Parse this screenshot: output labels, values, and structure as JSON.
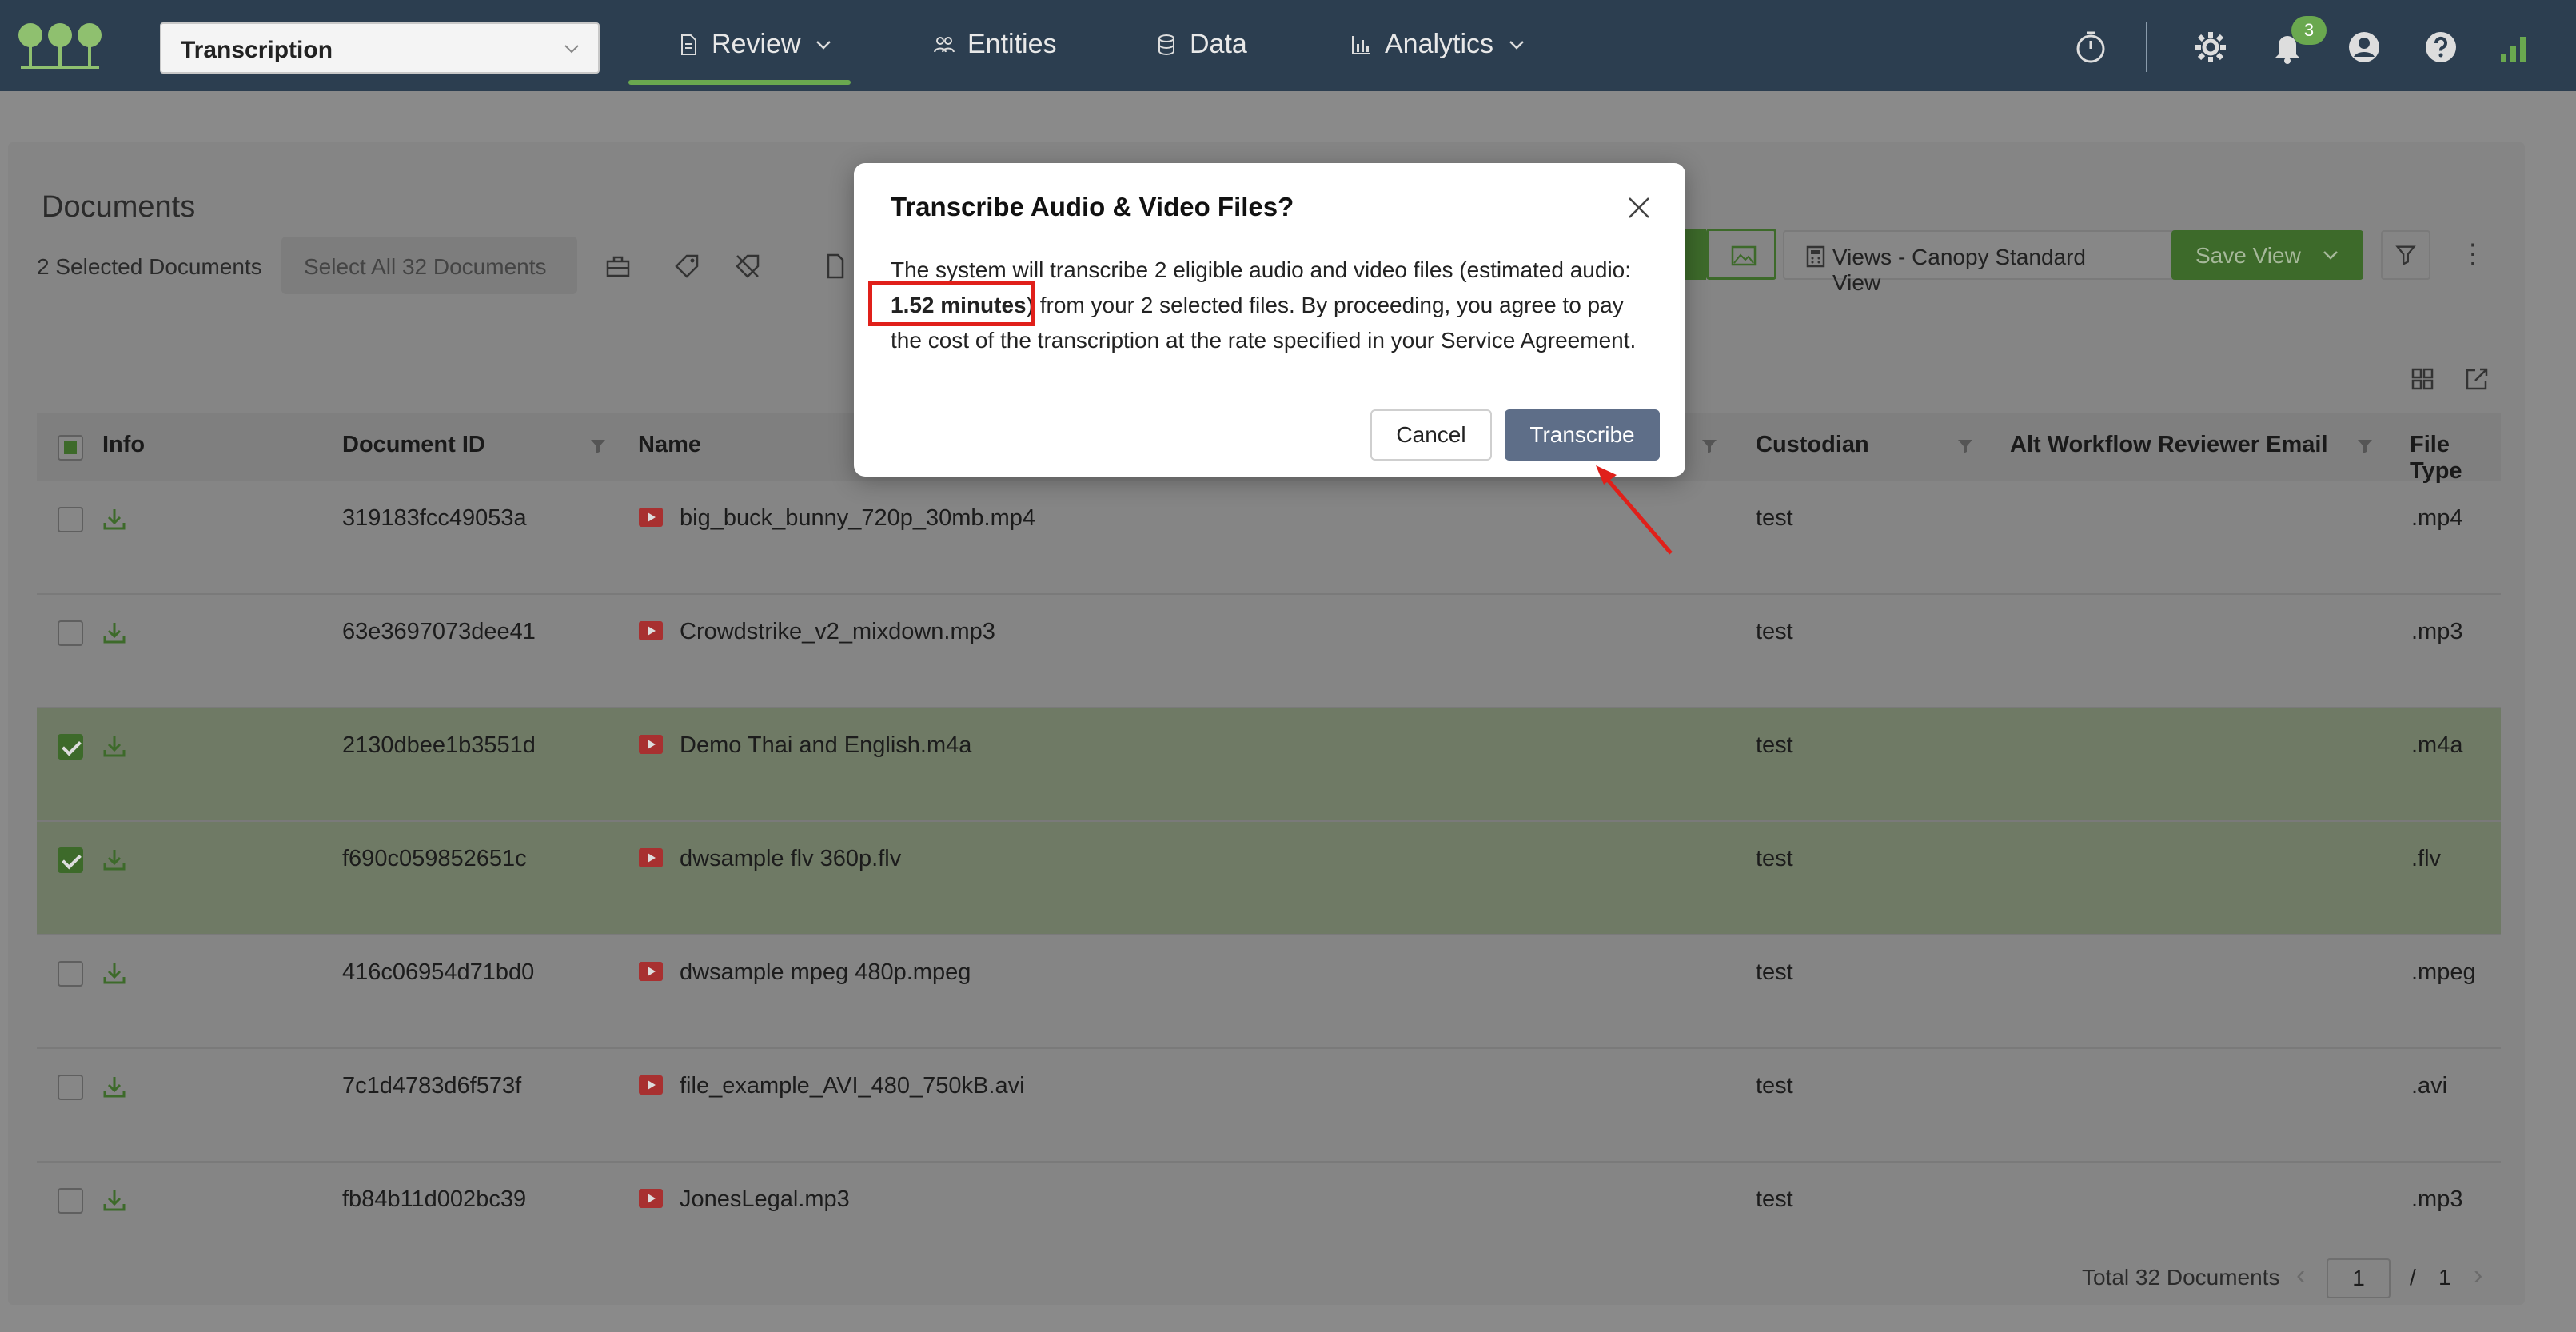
{
  "topbar": {
    "project": "Transcription",
    "nav": [
      {
        "label": "Review",
        "icon": "document-icon"
      },
      {
        "label": "Entities",
        "icon": "people-icon"
      },
      {
        "label": "Data",
        "icon": "database-icon"
      },
      {
        "label": "Analytics",
        "icon": "bar-chart-icon"
      }
    ],
    "notification_count": "3"
  },
  "documents": {
    "title": "Documents",
    "selected_label": "2 Selected Documents",
    "select_all_label": "Select All 32 Documents",
    "views_label": "Views - Canopy Standard View",
    "save_view_label": "Save View"
  },
  "table": {
    "headers": {
      "info": "Info",
      "document_id": "Document ID",
      "name": "Name",
      "custodian": "Custodian",
      "alt_email": "Alt Workflow Reviewer Email",
      "file_type": "File Type"
    },
    "rows": [
      {
        "id": "319183fcc49053a",
        "name": "big_buck_bunny_720p_30mb.mp4",
        "custodian": "test",
        "type": ".mp4",
        "selected": false
      },
      {
        "id": "63e3697073dee41",
        "name": "Crowdstrike_v2_mixdown.mp3",
        "custodian": "test",
        "type": ".mp3",
        "selected": false
      },
      {
        "id": "2130dbee1b3551d",
        "name": "Demo Thai and English.m4a",
        "custodian": "test",
        "type": ".m4a",
        "selected": true
      },
      {
        "id": "f690c059852651c",
        "name": "dwsample flv 360p.flv",
        "custodian": "test",
        "type": ".flv",
        "selected": true
      },
      {
        "id": "416c06954d71bd0",
        "name": "dwsample mpeg 480p.mpeg",
        "custodian": "test",
        "type": ".mpeg",
        "selected": false
      },
      {
        "id": "7c1d4783d6f573f",
        "name": "file_example_AVI_480_750kB.avi",
        "custodian": "test",
        "type": ".avi",
        "selected": false
      },
      {
        "id": "fb84b11d002bc39",
        "name": "JonesLegal.mp3",
        "custodian": "test",
        "type": ".mp3",
        "selected": false
      }
    ]
  },
  "footer": {
    "total": "Total 32 Documents",
    "page": "1",
    "sep": "/",
    "of": "1"
  },
  "modal": {
    "title": "Transcribe Audio & Video Files?",
    "body_pre": "The system will transcribe 2 eligible audio and video files (estimated audio: ",
    "body_bold": "1.52 minutes",
    "body_post": ") from your 2 selected files. By proceeding, you agree to pay the cost of the transcription at the rate specified in your Service Agreement.",
    "cancel": "Cancel",
    "confirm": "Transcribe"
  },
  "colors": {
    "nav_bg": "#2c3e50",
    "brand_green": "#6aa84f",
    "highlight_red": "#e0201a",
    "primary_button": "#5e6e88"
  }
}
